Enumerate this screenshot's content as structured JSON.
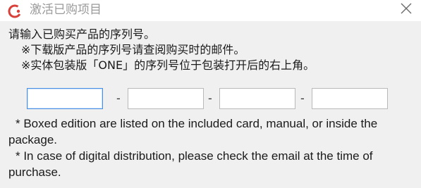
{
  "window": {
    "title": "激活已购项目",
    "accent_color": "#d8403a"
  },
  "instructions": {
    "line1": "请输入已购买产品的序列号。",
    "line2": "※下载版产品的序列号请查阅购买时的邮件。",
    "line3": "※实体包装版「ONE」的序列号位于包装打开后的右上角。"
  },
  "serial": {
    "field1_value": "",
    "field2_value": "",
    "field3_value": "",
    "field4_value": "",
    "separator": "-"
  },
  "notes": {
    "boxed": "* Boxed edition are listed on the included card, manual, or inside the package.",
    "digital": "* In case of digital distribution, please check the email at the time of purchase."
  }
}
